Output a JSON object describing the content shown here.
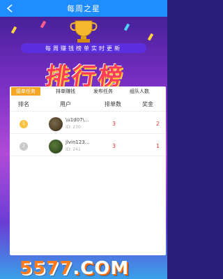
{
  "header": {
    "title": "每周之星",
    "back_icon": "chevron-left-icon"
  },
  "banner": {
    "subtitle": "每周赚钱榜单实时更新",
    "title": "排行榜",
    "trophy_icon": "trophy-icon"
  },
  "tabs": [
    {
      "label": "接单任务",
      "active": true
    },
    {
      "label": "排单赚钱",
      "active": false
    },
    {
      "label": "发布任务",
      "active": false
    },
    {
      "label": "组队人数",
      "active": false
    }
  ],
  "table": {
    "headers": [
      "排名",
      "用户",
      "排单数",
      "奖金"
    ],
    "rows": [
      {
        "rank": "1",
        "medal": "gold",
        "name": "\\u1d07\\...",
        "id": "ID: 230",
        "count": "3",
        "prize": "2"
      },
      {
        "rank": "2",
        "medal": "silver",
        "name": "jlvin123...",
        "id": "ID: 241",
        "count": "3",
        "prize": "1"
      }
    ]
  },
  "watermark": {
    "digits": "5577",
    "suffix": ".COM"
  },
  "colors": {
    "topbar": "#1f8cff",
    "active_tab": "#f5a623",
    "accent_red": "#ee3333"
  }
}
